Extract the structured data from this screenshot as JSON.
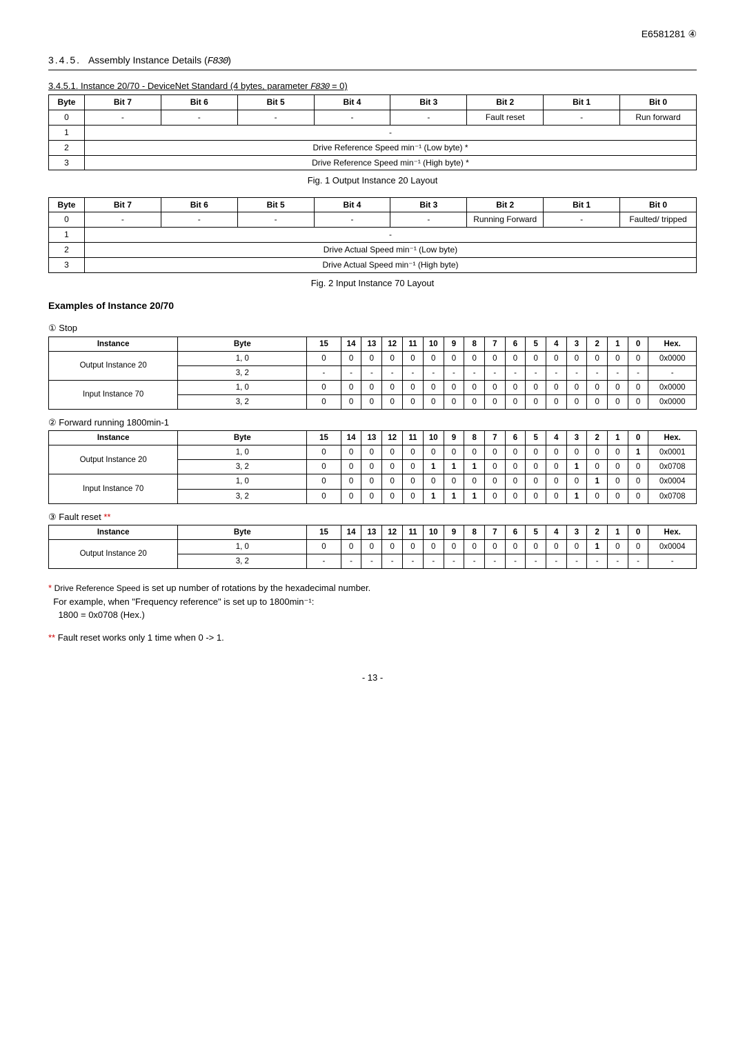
{
  "header": {
    "doc": "E6581281 ",
    "rev": "④"
  },
  "section": {
    "num": "3.4.5.",
    "title": "Assembly Instance Details (",
    "param1": "F830",
    "title_end": ")"
  },
  "sub1": {
    "num": "3.4.5.1.",
    "txt": "Instance 20/70 - DeviceNet Standard (4 bytes, parameter ",
    "param": "F830",
    "eq": " = 0)"
  },
  "table20": {
    "headers": [
      "Byte",
      "Bit 7",
      "Bit 6",
      "Bit 5",
      "Bit 4",
      "Bit 3",
      "Bit 2",
      "Bit 1",
      "Bit 0"
    ],
    "rows": [
      [
        "0",
        "-",
        "-",
        "-",
        "-",
        "-",
        "Fault reset",
        "-",
        "Run forward"
      ],
      [
        "1",
        "-"
      ],
      [
        "2",
        "Drive Reference Speed min⁻¹ (Low byte) *"
      ],
      [
        "3",
        "Drive Reference Speed min⁻¹ (High byte) *"
      ]
    ],
    "caption": "Fig. 1 Output Instance 20 Layout"
  },
  "table70": {
    "headers": [
      "Byte",
      "Bit 7",
      "Bit 6",
      "Bit 5",
      "Bit 4",
      "Bit 3",
      "Bit 2",
      "Bit 1",
      "Bit 0"
    ],
    "rows": [
      [
        "0",
        "-",
        "-",
        "-",
        "-",
        "-",
        "Running Forward",
        "-",
        "Faulted/ tripped"
      ],
      [
        "1",
        "-"
      ],
      [
        "2",
        "Drive Actual Speed min⁻¹ (Low byte)"
      ],
      [
        "3",
        "Drive Actual Speed min⁻¹ (High byte)"
      ]
    ],
    "caption": "Fig. 2 Input Instance 70 Layout"
  },
  "examples_title": "Examples of Instance 20/70",
  "bits_header": [
    "Instance",
    "Byte",
    "15",
    "14",
    "13",
    "12",
    "11",
    "10",
    "9",
    "8",
    "7",
    "6",
    "5",
    "4",
    "3",
    "2",
    "1",
    "0",
    "Hex."
  ],
  "ex1": {
    "label_num": "①",
    "label": "Stop",
    "rows": [
      {
        "instance": "Output Instance 20",
        "rowspan": 2,
        "byte": "1, 0",
        "vals": [
          "0",
          "0",
          "0",
          "0",
          "0",
          "0",
          "0",
          "0",
          "0",
          "0",
          "0",
          "0",
          "0",
          "0",
          "0",
          "0"
        ],
        "hex": "0x0000",
        "bold": []
      },
      {
        "byte": "3, 2",
        "vals": [
          "-",
          "-",
          "-",
          "-",
          "-",
          "-",
          "-",
          "-",
          "-",
          "-",
          "-",
          "-",
          "-",
          "-",
          "-",
          "-"
        ],
        "hex": "-",
        "bold": []
      },
      {
        "instance": "Input Instance 70",
        "rowspan": 2,
        "byte": "1, 0",
        "vals": [
          "0",
          "0",
          "0",
          "0",
          "0",
          "0",
          "0",
          "0",
          "0",
          "0",
          "0",
          "0",
          "0",
          "0",
          "0",
          "0"
        ],
        "hex": "0x0000",
        "bold": []
      },
      {
        "byte": "3, 2",
        "vals": [
          "0",
          "0",
          "0",
          "0",
          "0",
          "0",
          "0",
          "0",
          "0",
          "0",
          "0",
          "0",
          "0",
          "0",
          "0",
          "0"
        ],
        "hex": "0x0000",
        "bold": []
      }
    ]
  },
  "ex2": {
    "label_num": "②",
    "label": "Forward running 1800min-1",
    "rows": [
      {
        "instance": "Output Instance 20",
        "rowspan": 2,
        "byte": "1, 0",
        "vals": [
          "0",
          "0",
          "0",
          "0",
          "0",
          "0",
          "0",
          "0",
          "0",
          "0",
          "0",
          "0",
          "0",
          "0",
          "0",
          "1"
        ],
        "hex": "0x0001",
        "bold": [
          15
        ]
      },
      {
        "byte": "3, 2",
        "vals": [
          "0",
          "0",
          "0",
          "0",
          "0",
          "1",
          "1",
          "1",
          "0",
          "0",
          "0",
          "0",
          "1",
          "0",
          "0",
          "0"
        ],
        "hex": "0x0708",
        "bold": [
          5,
          6,
          7,
          12
        ]
      },
      {
        "instance": "Input Instance 70",
        "rowspan": 2,
        "byte": "1, 0",
        "vals": [
          "0",
          "0",
          "0",
          "0",
          "0",
          "0",
          "0",
          "0",
          "0",
          "0",
          "0",
          "0",
          "0",
          "1",
          "0",
          "0"
        ],
        "hex": "0x0004",
        "bold": [
          13
        ]
      },
      {
        "byte": "3, 2",
        "vals": [
          "0",
          "0",
          "0",
          "0",
          "0",
          "1",
          "1",
          "1",
          "0",
          "0",
          "0",
          "0",
          "1",
          "0",
          "0",
          "0"
        ],
        "hex": "0x0708",
        "bold": [
          5,
          6,
          7,
          12
        ]
      }
    ]
  },
  "ex3": {
    "label_num": "③",
    "label": "Fault reset ",
    "label_red": "**",
    "rows": [
      {
        "instance": "Output Instance 20",
        "rowspan": 2,
        "byte": "1, 0",
        "vals": [
          "0",
          "0",
          "0",
          "0",
          "0",
          "0",
          "0",
          "0",
          "0",
          "0",
          "0",
          "0",
          "0",
          "1",
          "0",
          "0"
        ],
        "hex": "0x0004",
        "bold": [
          13
        ]
      },
      {
        "byte": "3, 2",
        "vals": [
          "-",
          "-",
          "-",
          "-",
          "-",
          "-",
          "-",
          "-",
          "-",
          "-",
          "-",
          "-",
          "-",
          "-",
          "-",
          "-"
        ],
        "hex": "-",
        "bold": []
      }
    ]
  },
  "note1": {
    "star": "* ",
    "l1a": "Drive Reference Speed",
    "l1b": " is set up number of rotations by the hexadecimal number.",
    "l2": "For example, when \"Frequency reference\" is set up to 1800min⁻¹:",
    "l3": "1800 = 0x0708 (Hex.)"
  },
  "note2": {
    "star": "** ",
    "txt": "Fault reset works only 1 time when 0 -> 1."
  },
  "footer": "- 13 -"
}
